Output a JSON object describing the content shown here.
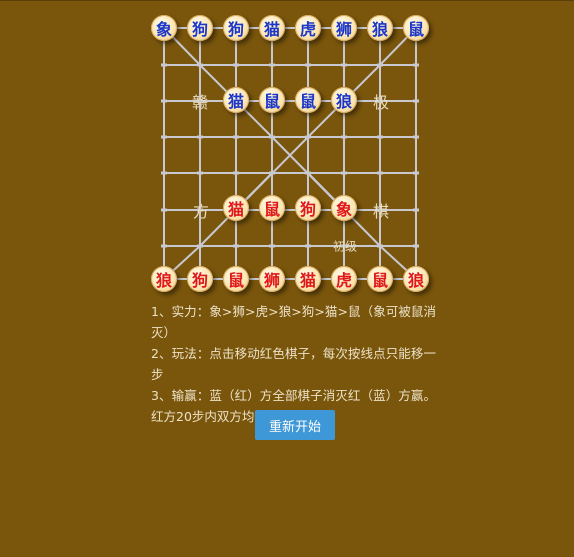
{
  "board": {
    "blue_back_row": [
      "象",
      "狗",
      "狗",
      "猫",
      "虎",
      "狮",
      "狼",
      "鼠"
    ],
    "blue_front_row": [
      "猫",
      "鼠",
      "鼠",
      "狼"
    ],
    "red_front_row": [
      "猫",
      "鼠",
      "狗",
      "象"
    ],
    "red_back_row": [
      "狼",
      "狗",
      "鼠",
      "狮",
      "猫",
      "虎",
      "鼠",
      "狼"
    ],
    "labels": {
      "left_top": "赣",
      "right_top": "极",
      "left_bottom": "方",
      "right_bottom": "棋"
    },
    "level": "初级",
    "colors": {
      "background": "#7a560c",
      "lines": "#c8c8d0",
      "blue_piece_text": "#1c36c8",
      "red_piece_text": "#e01818",
      "button": "#3e97d6"
    }
  },
  "rules": [
    "1、实力：象>狮>虎>狼>狗>猫>鼠（象可被鼠消灭）",
    "2、玩法：点击移动红色棋子，每次按线点只能移一步",
    "3、输赢：蓝（红）方全部棋子消灭红（蓝）方赢。红方20步内双方均无吃子红方输。"
  ],
  "restart_label": "重新开始"
}
